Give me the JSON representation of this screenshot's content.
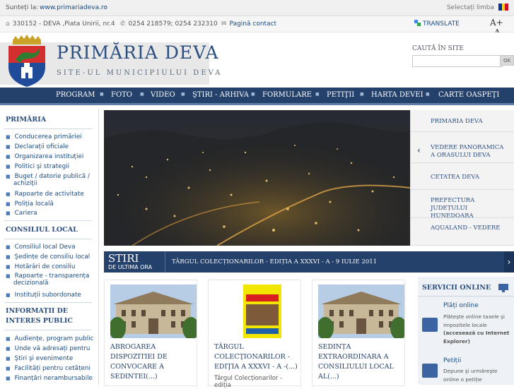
{
  "topbar": {
    "label": "Sunteți la:",
    "url": "www.primariadeva.ro",
    "chevron": "›",
    "lang_label": "Selectați limba",
    "flag_colors": [
      "#0033a0",
      "#fcd116",
      "#ce1126"
    ]
  },
  "contact": {
    "address": "330152 - DEVA ,Piata Unirii, nr.4",
    "phone": "0254 218579; 0254 232310",
    "contact_link": "Pagină contact",
    "translate": "TRANSLATE",
    "font_up": "A+",
    "font_down": "A-"
  },
  "header": {
    "title": "PRIMĂRIA DEVA",
    "subtitle": "SITE-UL MUNICIPIULUI DEVA",
    "search_label": "CAUTĂ ÎN SITE",
    "search_placeholder": "",
    "search_button": "OK"
  },
  "nav": [
    "PROGRAM",
    "FOTO",
    "VIDEO",
    "ŞTIRI - ARHIVA",
    "FORMULARE",
    "PETIŢII",
    "HARTA DEVEI",
    "CARTE OASPEŢI"
  ],
  "sidebar": {
    "sections": [
      {
        "title": "PRIMĂRIA",
        "items": [
          "Conducerea primăriei",
          "Declarații oficiale",
          "Organizarea instituției",
          "Politici şi strategii",
          "Buget / datorie publică /",
          "Rapoarte de activitate",
          "Poliția locală",
          "Cariera"
        ],
        "continuations": {
          "4": "achiziții"
        }
      },
      {
        "title": "CONSILIUL LOCAL",
        "items": [
          "Consiliul local Deva",
          "Şedințe de consiliu local",
          "Hotărâri de consiliu",
          "Rapoarte - transparența",
          "Instituții subordonate"
        ],
        "continuations": {
          "3": "decizională"
        }
      },
      {
        "title_lines": [
          "INFORMAȚII DE",
          "INTERES PUBLIC"
        ],
        "items": [
          "Audiențe, program public",
          "Unde vă adresați pentru",
          "Ştiri şi evenimente",
          "Facilități pentru cetățeni",
          "Finanțări nerambursabile"
        ]
      }
    ]
  },
  "slider_links": [
    "PRIMARIA DEVA",
    "VEDERE PANORAMICA A ORASULUI DEVA",
    "CETATEA DEVA",
    "PREFECTURA JUDEȚULUI HUNEDOARA",
    "AQUALAND - VEDERE"
  ],
  "ticker": {
    "title": "STIRI",
    "subtitle": "DE ULTIMA ORA",
    "headline": "TÂRGUL COLECȚIONARILOR - EDIȚIA A XXXVI - A - 9 IULIE 2011",
    "next": "›"
  },
  "cards": [
    {
      "title_lines": [
        "ABROGAREA",
        "DISPOZITIEI DE",
        "CONVOCARE A",
        "SEDINTEI(...)"
      ],
      "text": ""
    },
    {
      "title_lines": [
        "TÂRGUL",
        "COLECŢIONARILOR -",
        "EDIŢIA A XXXVI - A -(...)"
      ],
      "text": "Târgul Colecționarilor - ediția"
    },
    {
      "title_lines": [
        "SEDINȚA",
        "EXTRAORDINARA A",
        "CONSILIULUI LOCAL",
        "AL(...)"
      ],
      "text": ""
    }
  ],
  "services": {
    "title": "SERVICII ONLINE",
    "items": [
      {
        "title": "Plăți online",
        "desc": [
          "Plătește online taxele şi",
          "impozitele locale",
          "(accesează cu Internet",
          "Explorer)"
        ]
      },
      {
        "title": "Petiții",
        "desc": [
          "Depune şi urmăreşte",
          "online o petiție"
        ]
      }
    ]
  }
}
